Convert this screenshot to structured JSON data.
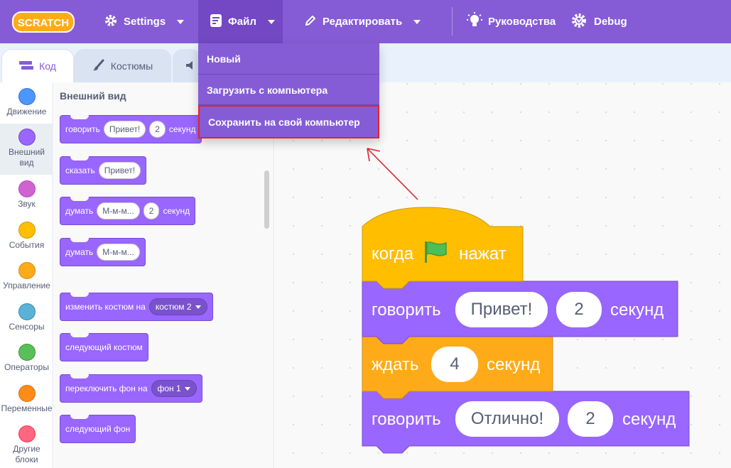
{
  "menubar": {
    "logo_text": "SCRATCH",
    "settings_label": "Settings",
    "file_label": "Файл",
    "edit_label": "Редактировать",
    "tutorials_label": "Руководства",
    "debug_label": "Debug"
  },
  "file_menu": {
    "items": [
      {
        "label": "Новый"
      },
      {
        "label": "Загрузить с компьютера"
      },
      {
        "label": "Сохранить на свой компьютер"
      }
    ]
  },
  "tabs": {
    "code": "Код",
    "costumes": "Костюмы"
  },
  "categories": [
    {
      "label": "Движение",
      "color": "#4c97ff"
    },
    {
      "label": "Внешний вид",
      "color": "#9966ff"
    },
    {
      "label": "Звук",
      "color": "#cf63cf"
    },
    {
      "label": "События",
      "color": "#ffbf00"
    },
    {
      "label": "Управление",
      "color": "#ffab19"
    },
    {
      "label": "Сенсоры",
      "color": "#5cb1d6"
    },
    {
      "label": "Операторы",
      "color": "#59c059"
    },
    {
      "label": "Переменные",
      "color": "#ff8c1a"
    },
    {
      "label": "Другие блоки",
      "color": "#ff6680"
    }
  ],
  "palette": {
    "title": "Внешний вид",
    "say_for": {
      "verb": "говорить",
      "arg1": "Привет!",
      "arg2": "2",
      "unit": "секунд"
    },
    "say": {
      "verb": "сказать",
      "arg1": "Привет!"
    },
    "think_for": {
      "verb": "думать",
      "arg1": "М-м-м...",
      "arg2": "2",
      "unit": "секунд"
    },
    "think": {
      "verb": "думать",
      "arg1": "М-м-м..."
    },
    "switch_costume": {
      "verb": "изменить костюм на",
      "value": "костюм 2"
    },
    "next_costume": {
      "verb": "следующий костюм"
    },
    "switch_backdrop": {
      "verb": "переключить фон на",
      "value": "фон 1"
    },
    "next_backdrop": {
      "verb": "следующий фон"
    }
  },
  "script": {
    "hat": {
      "left": "когда",
      "right": "нажат",
      "icon": "green-flag-icon"
    },
    "say1": {
      "verb": "говорить",
      "arg1": "Привет!",
      "arg2": "2",
      "unit": "секунд"
    },
    "wait": {
      "verb": "ждать",
      "arg1": "4",
      "unit": "секунд"
    },
    "say2": {
      "verb": "говорить",
      "arg1": "Отлично!",
      "arg2": "2",
      "unit": "секунд"
    }
  },
  "colors": {
    "menubar": "#855cd6",
    "looks": "#9966ff",
    "events": "#ffbf00",
    "control": "#ffab19",
    "highlight": "#e0242f"
  }
}
